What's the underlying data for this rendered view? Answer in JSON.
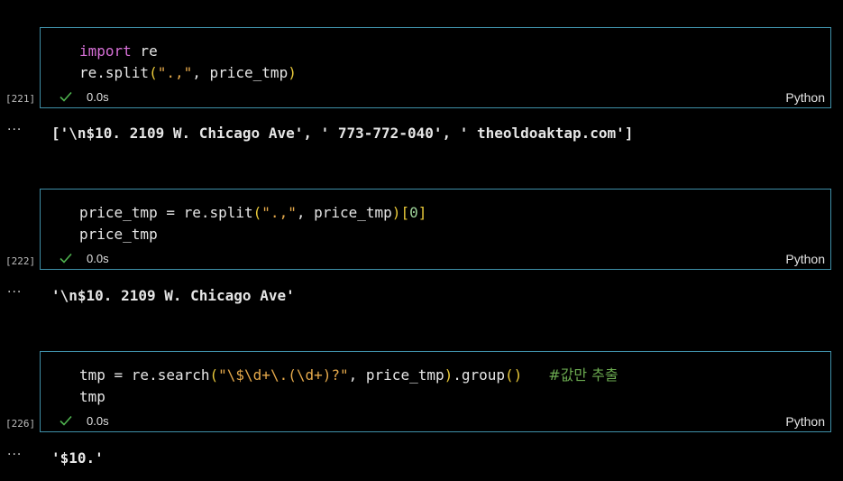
{
  "cells": [
    {
      "execution_count": "[221]",
      "code": {
        "line1_kw": "import",
        "line1_rest": " re",
        "line2_a": "re.split",
        "line2_paren_open": "(",
        "line2_str": "\".,\"",
        "line2_b": ", price_tmp",
        "line2_paren_close": ")"
      },
      "status_time": "0.0s",
      "language": "Python",
      "output": "['\\n$10. 2109 W. Chicago Ave', ' 773-772-040', ' theoldoaktap.com']"
    },
    {
      "execution_count": "[222]",
      "code": {
        "line1_a": "price_tmp = re.split",
        "line1_paren_open": "(",
        "line1_str": "\".,\"",
        "line1_b": ", price_tmp",
        "line1_paren_close": ")",
        "line1_bracket_open": "[",
        "line1_num": "0",
        "line1_bracket_close": "]",
        "line2": "price_tmp"
      },
      "status_time": "0.0s",
      "language": "Python",
      "output": "'\\n$10. 2109 W. Chicago Ave'"
    },
    {
      "execution_count": "[226]",
      "code": {
        "line1_a": "tmp = re.search",
        "line1_paren_open": "(",
        "line1_str": "\"\\$\\d+\\.(\\d+)?\"",
        "line1_b": ", price_tmp",
        "line1_paren_close": ")",
        "line1_c": ".group",
        "line1_call": "()",
        "line1_comment": "#값만 추출",
        "line2": "tmp"
      },
      "status_time": "0.0s",
      "language": "Python",
      "output": "'$10.'"
    }
  ],
  "output_menu_glyph": "···",
  "colors": {
    "cell_border": "#3f8fa8",
    "keyword": "#d670d6",
    "string": "#e5a94b",
    "bracket": "#e9c93a",
    "number": "#9ed39a",
    "comment": "#6aa84f",
    "success_check": "#4fb34f"
  }
}
